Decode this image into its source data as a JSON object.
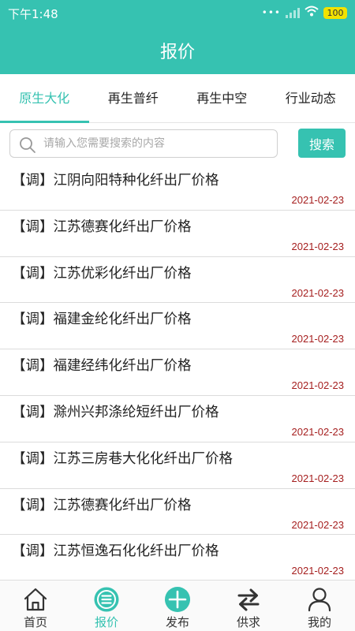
{
  "status_bar": {
    "time": "下午1:48",
    "battery": "100"
  },
  "header": {
    "title": "报价"
  },
  "tabs": [
    {
      "label": "原生大化",
      "active": true
    },
    {
      "label": "再生普纤",
      "active": false
    },
    {
      "label": "再生中空",
      "active": false
    },
    {
      "label": "行业动态",
      "active": false
    }
  ],
  "search": {
    "placeholder": "请输入您需要搜索的内容",
    "value": "",
    "button_label": "搜索"
  },
  "list": [
    {
      "title": "【调】江阴向阳特种化纤出厂价格",
      "date": "2021-02-23"
    },
    {
      "title": "【调】江苏德赛化纤出厂价格",
      "date": "2021-02-23"
    },
    {
      "title": "【调】江苏优彩化纤出厂价格",
      "date": "2021-02-23"
    },
    {
      "title": "【调】福建金纶化纤出厂价格",
      "date": "2021-02-23"
    },
    {
      "title": "【调】福建经纬化纤出厂价格",
      "date": "2021-02-23"
    },
    {
      "title": "【调】滁州兴邦涤纶短纤出厂价格",
      "date": "2021-02-23"
    },
    {
      "title": "【调】江苏三房巷大化化纤出厂价格",
      "date": "2021-02-23"
    },
    {
      "title": "【调】江苏德赛化纤出厂价格",
      "date": "2021-02-23"
    },
    {
      "title": "【调】江苏恒逸石化化纤出厂价格",
      "date": "2021-02-23"
    }
  ],
  "bottom_nav": [
    {
      "label": "首页",
      "icon": "home-icon"
    },
    {
      "label": "报价",
      "icon": "quote-list-icon",
      "active": true
    },
    {
      "label": "发布",
      "icon": "plus-circle-icon"
    },
    {
      "label": "供求",
      "icon": "swap-arrows-icon"
    },
    {
      "label": "我的",
      "icon": "user-icon"
    }
  ],
  "colors": {
    "accent": "#36c2b1",
    "date": "#a51e1e",
    "battery": "#f2e200"
  }
}
